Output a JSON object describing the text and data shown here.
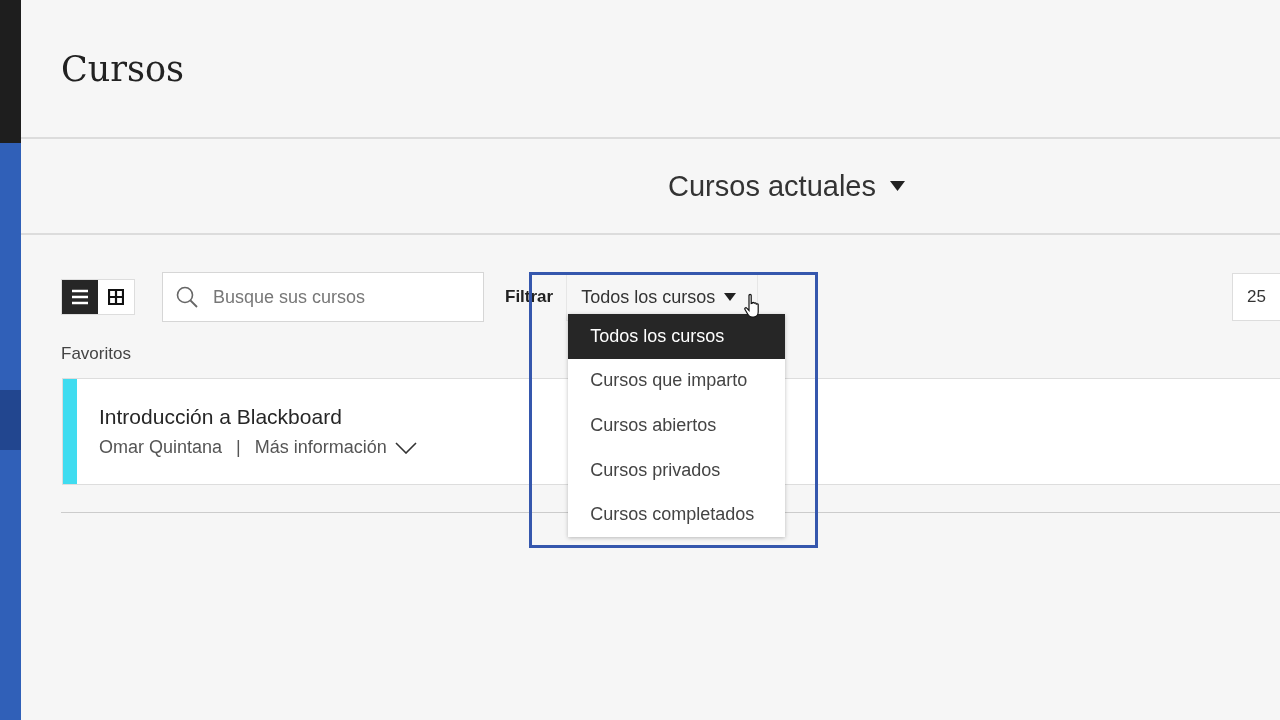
{
  "page_title": "Cursos",
  "term_selector": {
    "label": "Cursos actuales"
  },
  "view_toggle": [
    {
      "kind": "list",
      "selected": true
    },
    {
      "kind": "grid",
      "selected": false
    }
  ],
  "search": {
    "placeholder": "Busque sus cursos"
  },
  "filter": {
    "label": "Filtrar",
    "value": "Todos los cursos",
    "expanded": true,
    "options": [
      {
        "label": "Todos los cursos",
        "selected": true
      },
      {
        "label": "Cursos que imparto",
        "selected": false
      },
      {
        "label": "Cursos abiertos",
        "selected": false
      },
      {
        "label": "Cursos privados",
        "selected": false
      },
      {
        "label": "Cursos completados",
        "selected": false
      }
    ]
  },
  "page_size": {
    "value": "25"
  },
  "sections": [
    {
      "title": "Favoritos",
      "courses": [
        {
          "name": "Introducción a Blackboard",
          "instructor": "Omar Quintana",
          "separator": "|",
          "more_link": "Más información"
        }
      ]
    }
  ]
}
